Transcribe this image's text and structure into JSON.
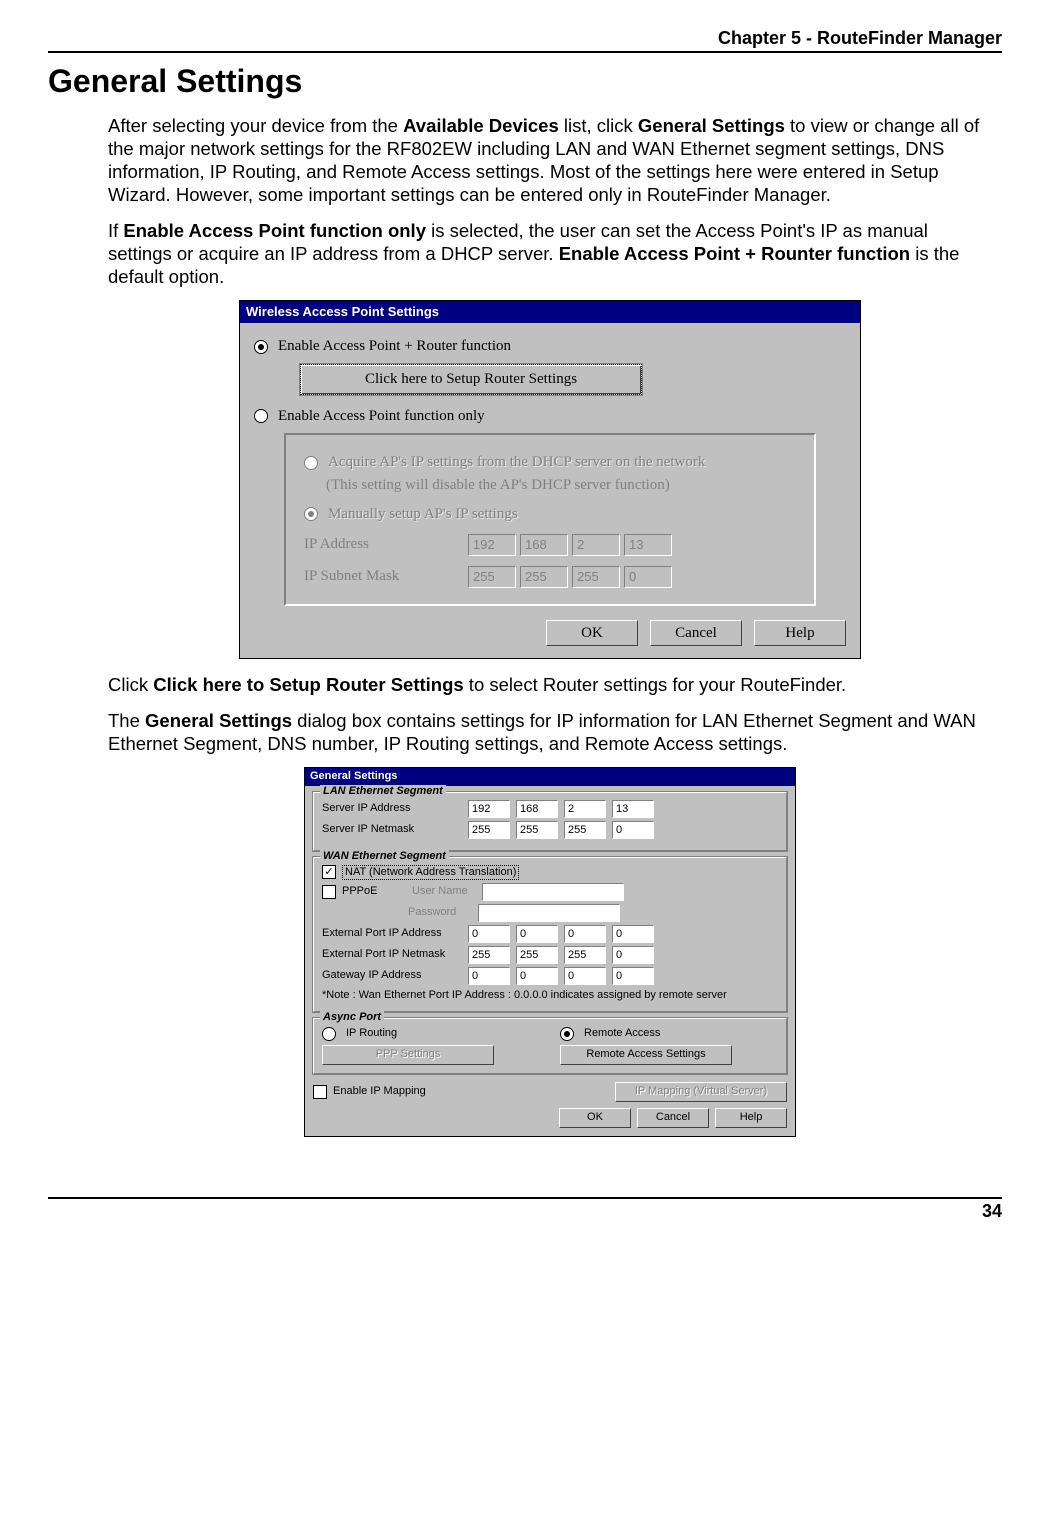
{
  "header": {
    "chapter": "Chapter 5 - RouteFinder Manager"
  },
  "h1": "General Settings",
  "para1_before": "After selecting your device from the ",
  "para1_b1": "Available Devices",
  "para1_mid1": " list, click ",
  "para1_b2": "General Settings",
  "para1_after": " to view or change all of the major network settings for the RF802EW including LAN and WAN Ethernet segment settings, DNS information, IP Routing, and Remote Access settings.  Most of the settings here were entered in Setup Wizard.  However, some important settings can be entered only in RouteFinder Manager.",
  "para2_before": "If ",
  "para2_b1": "Enable Access Point function only",
  "para2_mid": " is selected, the user can set the Access Point's IP as manual settings or acquire an IP address from a DHCP server.  ",
  "para2_b2": "Enable Access Point + Rounter function",
  "para2_after": " is the default option.",
  "fig1": {
    "title": "Wireless Access Point Settings",
    "opt1": "Enable Access Point + Router function",
    "setupBtn": "Click here to Setup Router Settings",
    "opt2": "Enable Access Point function only",
    "subOpt1": "Acquire AP's IP settings from the DHCP server on the network",
    "subNote": "(This setting will disable the AP's DHCP server function)",
    "subOpt2": "Manually setup AP's IP settings",
    "ipLabel": "IP Address",
    "maskLabel": "IP Subnet Mask",
    "ip": [
      "192",
      "168",
      "2",
      "13"
    ],
    "mask": [
      "255",
      "255",
      "255",
      "0"
    ],
    "ok": "OK",
    "cancel": "Cancel",
    "help": "Help"
  },
  "para3_before": "Click ",
  "para3_b": "Click here to Setup Router Settings",
  "para3_after": " to select Router settings for your RouteFinder.",
  "para4_before": "The ",
  "para4_b": "General Settings",
  "para4_after": " dialog box contains settings for IP information for LAN Ethernet Segment and WAN Ethernet Segment, DNS number, IP Routing settings, and Remote Access settings.",
  "fig2": {
    "title": "General Settings",
    "lanLegend": "LAN Ethernet Segment",
    "lanIpLabel": "Server IP Address",
    "lanMaskLabel": "Server IP Netmask",
    "lanIp": [
      "192",
      "168",
      "2",
      "13"
    ],
    "lanMask": [
      "255",
      "255",
      "255",
      "0"
    ],
    "wanLegend": "WAN Ethernet Segment",
    "nat": "NAT (Network Address Translation)",
    "pppoe": "PPPoE",
    "userName": "User Name",
    "password": "Password",
    "extIpLabel": "External Port IP Address",
    "extMaskLabel": "External Port IP Netmask",
    "gwLabel": "Gateway IP Address",
    "extIp": [
      "0",
      "0",
      "0",
      "0"
    ],
    "extMask": [
      "255",
      "255",
      "255",
      "0"
    ],
    "gw": [
      "0",
      "0",
      "0",
      "0"
    ],
    "note": "*Note : Wan Ethernet Port IP Address : 0.0.0.0  indicates assigned by remote server",
    "asyncLegend": "Async Port",
    "ipRouting": "IP Routing",
    "remoteAccess": "Remote Access",
    "pppBtn": "PPP Settings",
    "remoteBtn": "Remote Access Settings",
    "enableMap": "Enable IP Mapping",
    "ipMapBtn": "IP Mapping (Virtual Server)",
    "ok": "OK",
    "cancel": "Cancel",
    "help": "Help"
  },
  "pageNum": "34"
}
